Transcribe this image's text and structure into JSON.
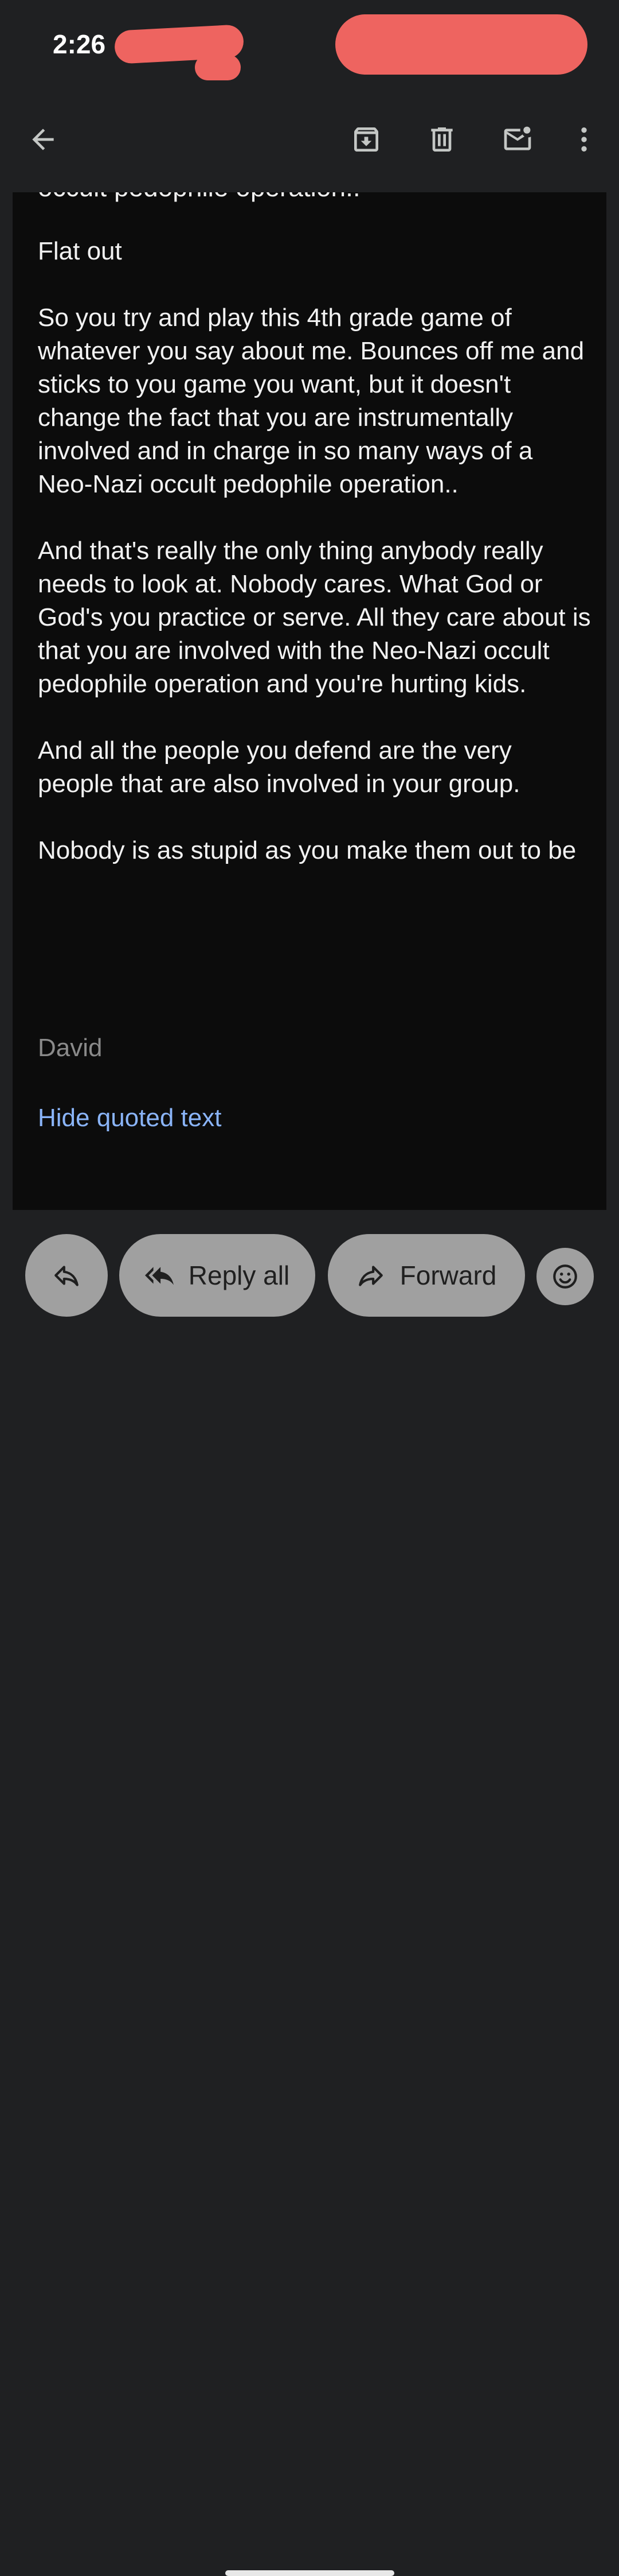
{
  "status_bar": {
    "time": "2:26"
  },
  "toolbar": {
    "back_icon": "arrow-left-icon",
    "archive_icon": "archive-icon",
    "delete_icon": "trash-icon",
    "mark_unread_icon": "mail-unread-icon",
    "more_icon": "more-vert-icon"
  },
  "email": {
    "cut_line": "occult pedophile operation..",
    "paragraphs": [
      "Flat out",
      "So you try and play this 4th grade game of whatever you say about me. Bounces off me and sticks to you game you want, but it doesn't change the fact that you are instrumentally involved and in charge in so many ways of a Neo-Nazi occult pedophile operation..",
      "And that's really the only thing anybody really needs to look at. Nobody cares. What God or God's you practice or serve. All they care about is that you are involved with the Neo-Nazi occult pedophile operation and you're hurting kids.",
      "And all the people you defend are the very people that are also involved in your group.",
      "Nobody is as stupid as you make them out to be"
    ],
    "signature": "David",
    "hide_quoted": "Hide quoted text"
  },
  "actions": {
    "reply_all": "Reply all",
    "forward": "Forward"
  },
  "colors": {
    "background": "#1f2022",
    "content_bg": "#0c0c0c",
    "link": "#8ab4f8",
    "pill": "#a0a0a0",
    "redaction": "#ee6460"
  }
}
